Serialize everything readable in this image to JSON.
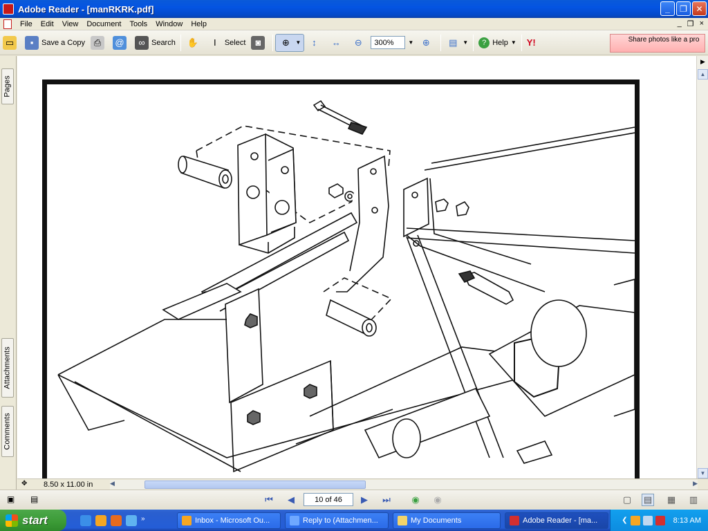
{
  "window": {
    "title": "Adobe Reader - [manRKRK.pdf]",
    "buttons": [
      "_",
      "❐",
      "✕"
    ]
  },
  "menu": [
    "File",
    "Edit",
    "View",
    "Document",
    "Tools",
    "Window",
    "Help"
  ],
  "mdi_buttons": [
    "_",
    "❐",
    "×"
  ],
  "toolbar": {
    "save_copy": "Save a Copy",
    "search": "Search",
    "select": "Select",
    "zoom_value": "300%",
    "help": "Help",
    "share": "Share photos like a pro"
  },
  "leftnav": {
    "pages": "Pages",
    "attachments": "Attachments",
    "comments": "Comments"
  },
  "status": {
    "page_size": "8.50 x 11.00 in"
  },
  "navigation": {
    "page_indicator": "10 of 46"
  },
  "taskbar": {
    "start": "start",
    "tasks": [
      {
        "label": "Inbox - Microsoft Ou...",
        "color": "#f5a623"
      },
      {
        "label": "Reply to (Attachmen...",
        "color": "#6fa8ff"
      },
      {
        "label": "My Documents",
        "color": "#f3d36b"
      },
      {
        "label": "Adobe Reader - [ma...",
        "color": "#d32f2f"
      }
    ],
    "clock": "8:13 AM"
  },
  "colors": {
    "titlebar": "#0454e2",
    "taskbar": "#245dd7",
    "start": "#3b9a36",
    "tray": "#0d8ce0"
  }
}
